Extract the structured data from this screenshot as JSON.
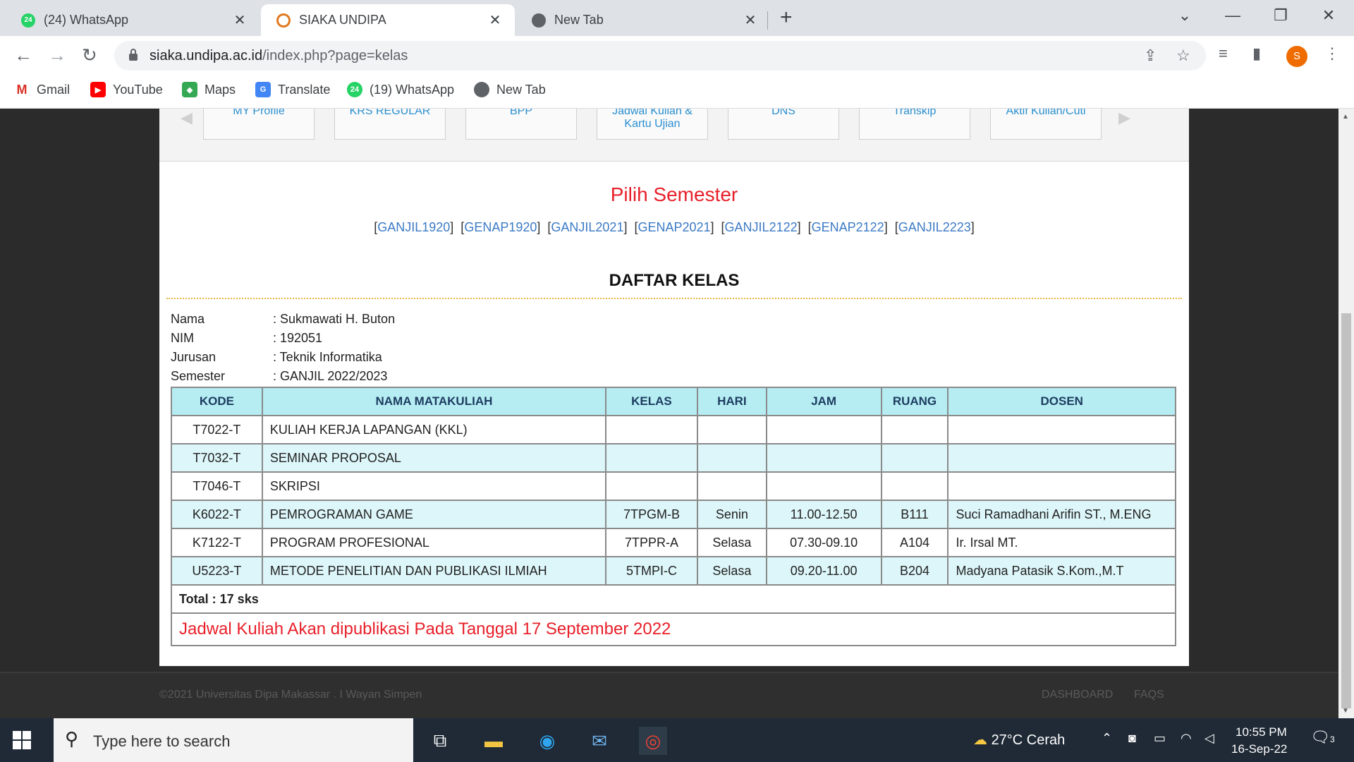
{
  "browser": {
    "tabs": [
      {
        "title": "(24) WhatsApp",
        "badge": "24"
      },
      {
        "title": "SIAKA UNDIPA"
      },
      {
        "title": "New Tab"
      }
    ],
    "url_domain": "siaka.undipa.ac.id",
    "url_path": "/index.php?page=kelas",
    "profile_initial": "S",
    "bookmarks": [
      {
        "label": "Gmail"
      },
      {
        "label": "YouTube"
      },
      {
        "label": "Maps"
      },
      {
        "label": "Translate"
      },
      {
        "label": "(19) WhatsApp",
        "badge": "24"
      },
      {
        "label": "New Tab"
      }
    ]
  },
  "menu": {
    "items": [
      "MY Profile",
      "KRS REGULAR",
      "BPP",
      "Jadwal Kuliah & Kartu Ujian",
      "DNS",
      "Transkip",
      "Aktif Kuliah/Cuti"
    ]
  },
  "semester": {
    "title": "Pilih Semester",
    "links": [
      "GANJIL1920",
      "GENAP1920",
      "GANJIL2021",
      "GENAP2021",
      "GANJIL2122",
      "GENAP2122",
      "GANJIL2223"
    ]
  },
  "daftar": {
    "title": "DAFTAR KELAS",
    "info": [
      {
        "label": "Nama",
        "value": ": Sukmawati H. Buton"
      },
      {
        "label": "NIM",
        "value": ": 192051"
      },
      {
        "label": "Jurusan",
        "value": ": Teknik Informatika"
      },
      {
        "label": "Semester",
        "value": ": GANJIL 2022/2023"
      }
    ],
    "headers": [
      "KODE",
      "NAMA MATAKULIAH",
      "KELAS",
      "HARI",
      "JAM",
      "RUANG",
      "DOSEN"
    ],
    "rows": [
      [
        "T7022-T",
        "KULIAH KERJA LAPANGAN (KKL)",
        "",
        "",
        "",
        "",
        ""
      ],
      [
        "T7032-T",
        "SEMINAR PROPOSAL",
        "",
        "",
        "",
        "",
        ""
      ],
      [
        "T7046-T",
        "SKRIPSI",
        "",
        "",
        "",
        "",
        ""
      ],
      [
        "K6022-T",
        "PEMROGRAMAN GAME",
        "7TPGM-B",
        "Senin",
        "11.00-12.50",
        "B111",
        "Suci Ramadhani Arifin ST., M.ENG"
      ],
      [
        "K7122-T",
        "PROGRAM PROFESIONAL",
        "7TPPR-A",
        "Selasa",
        "07.30-09.10",
        "A104",
        "Ir. Irsal MT."
      ],
      [
        "U5223-T",
        "METODE PENELITIAN DAN PUBLIKASI ILMIAH",
        "5TMPI-C",
        "Selasa",
        "09.20-11.00",
        "B204",
        "Madyana Patasik S.Kom.,M.T"
      ]
    ],
    "total": "Total : 17 sks",
    "notice": "Jadwal Kuliah Akan dipublikasi Pada Tanggal 17 September 2022"
  },
  "footer": {
    "copyright": "©2021 Universitas Dipa Makassar . I Wayan Simpen",
    "links": [
      "DASHBOARD",
      "FAQS"
    ]
  },
  "taskbar": {
    "search_placeholder": "Type here to search",
    "weather": "27°C  Cerah",
    "time": "10:55 PM",
    "date": "16-Sep-22",
    "notification_count": "3"
  },
  "colors": {
    "accent_red": "#e8202a",
    "link_blue": "#3c7ac5",
    "table_header": "#b6edf3",
    "table_alt_row": "#ddf6f9"
  }
}
